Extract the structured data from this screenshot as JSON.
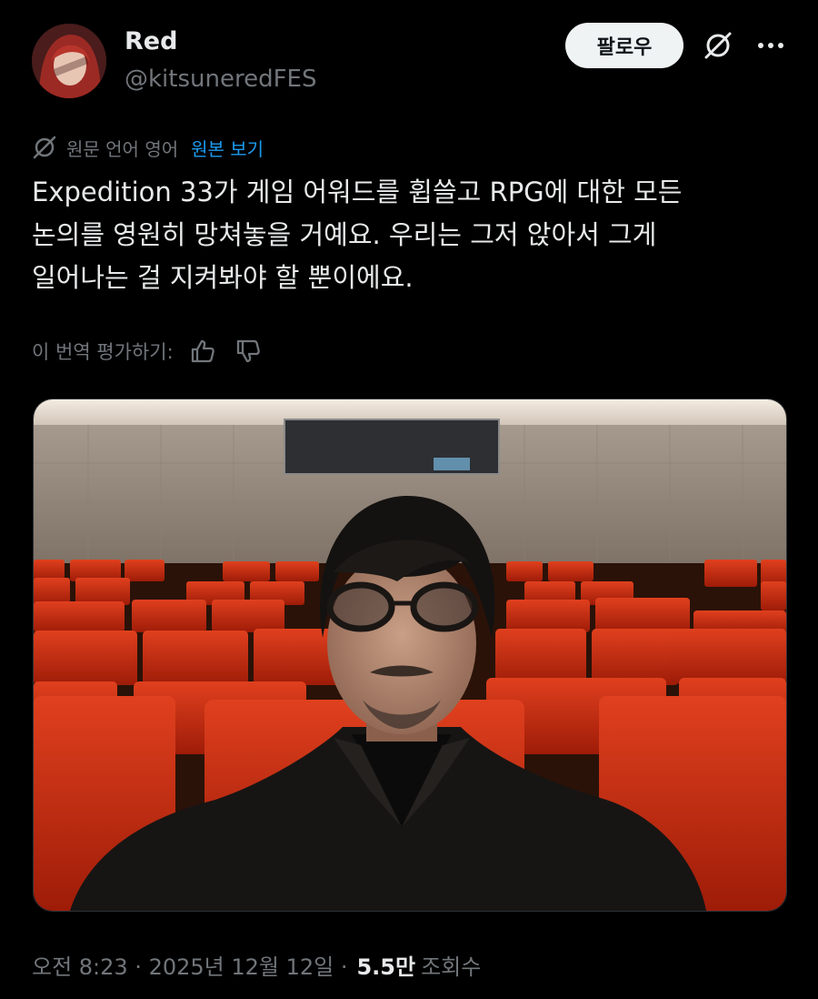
{
  "author": {
    "display_name": "Red",
    "handle": "@kitsuneredFES",
    "avatar_icon": "avatar-red-haired-character"
  },
  "actions": {
    "follow_label": "팔로우",
    "grok_icon": "grok-icon",
    "more_icon": "more-icon"
  },
  "translation": {
    "notice": "원문 언어 영어",
    "show_original_label": "원본 보기",
    "rate_label": "이 번역 평가하기:"
  },
  "tweet": {
    "text": "Expedition 33가 게임 어워드를 휩쓸고 RPG에 대한 모든\n논의를 영원히 망쳐놓을 거예요. 우리는 그저 앉아서 그게\n일어나는 걸 지켜봐야 할 뿐이에요.",
    "image_icon": "photo-man-in-empty-theater"
  },
  "meta": {
    "timestamp": "오전 8:23 · 2025년 12월 12일 ·",
    "views_count": "5.5만",
    "views_label": "조회수"
  },
  "colors": {
    "background": "#000000",
    "link": "#1d9bf0",
    "muted": "#71767b",
    "text": "#e7e9ea",
    "seat": "#c0250c"
  }
}
